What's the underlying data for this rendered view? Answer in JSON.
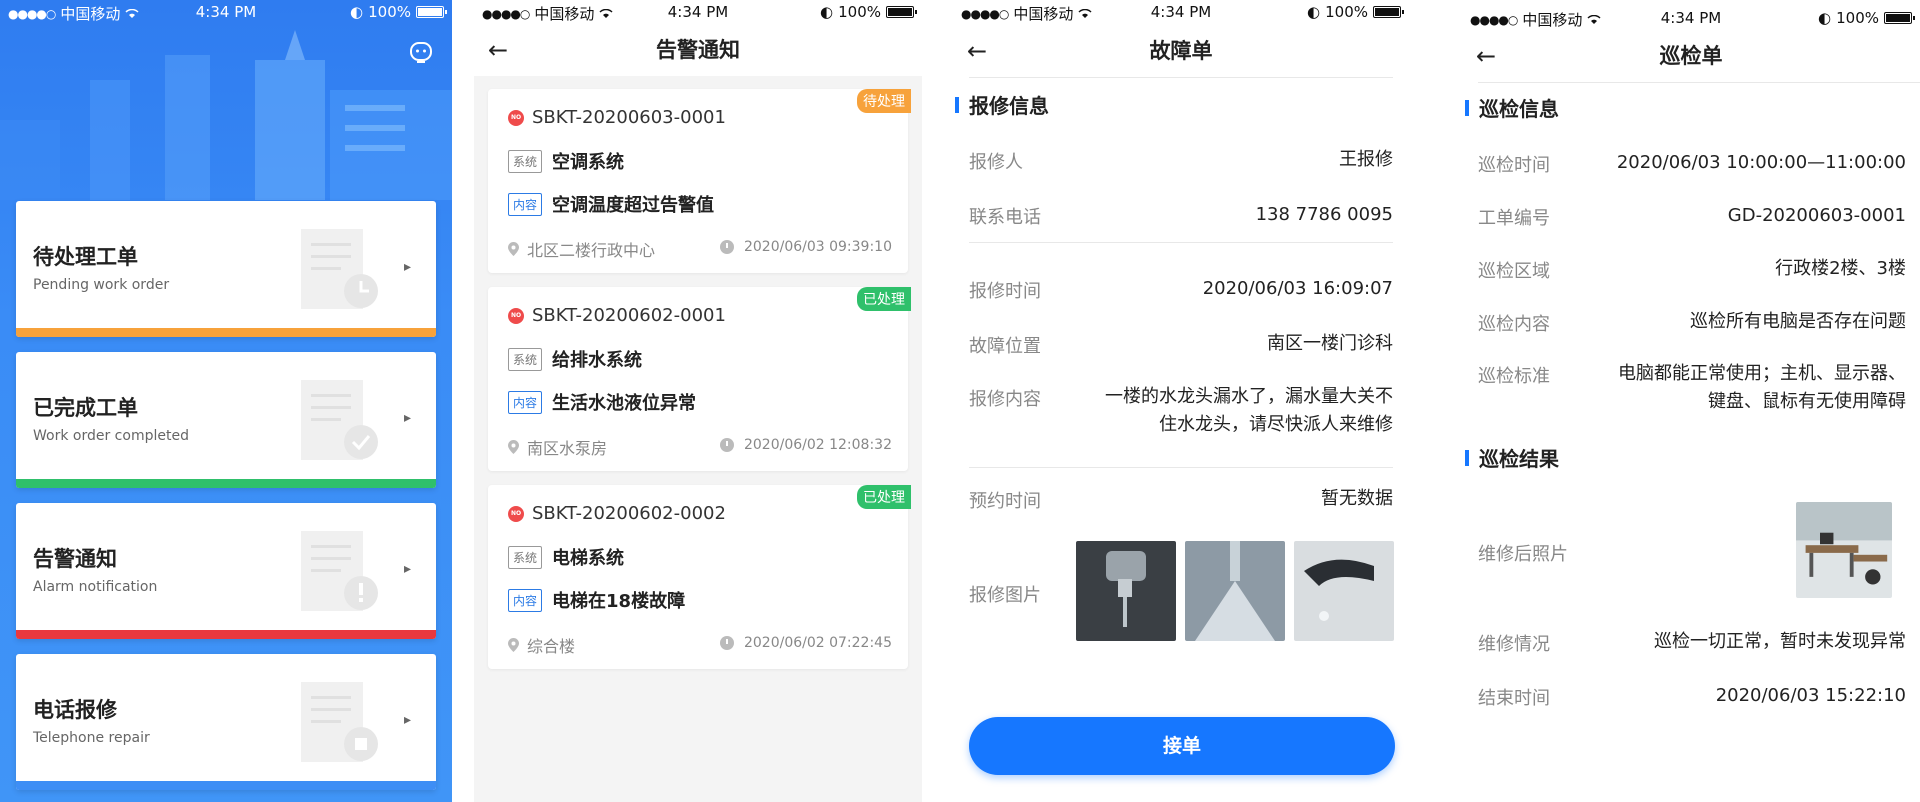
{
  "status_bar": {
    "carrier": "中国移动",
    "time": "4:34 PM",
    "battery": "100%"
  },
  "home": {
    "cards": [
      {
        "title": "待处理工单",
        "subtitle": "Pending work order",
        "color": "#f7a23b",
        "icon": "clock-doc-icon"
      },
      {
        "title": "已完成工单",
        "subtitle": "Work order completed",
        "color": "#2fc06b",
        "icon": "check-doc-icon"
      },
      {
        "title": "告警通知",
        "subtitle": "Alarm notification",
        "color": "#e9383f",
        "icon": "alert-doc-icon"
      },
      {
        "title": "电话报修",
        "subtitle": "Telephone repair",
        "color": "#3e8ef5",
        "icon": "phone-doc-icon"
      }
    ]
  },
  "alarms": {
    "title": "告警通知",
    "tag_system": "系统",
    "tag_content": "内容",
    "items": [
      {
        "code": "SBKT-20200603-0001",
        "status": "待处理",
        "status_color": "#f7a23b",
        "system": "空调系统",
        "content": "空调温度超过告警值",
        "location": "北区二楼行政中心",
        "datetime": "2020/06/03 09:39:10"
      },
      {
        "code": "SBKT-20200602-0001",
        "status": "已处理",
        "status_color": "#2fc06b",
        "system": "给排水系统",
        "content": "生活水池液位异常",
        "location": "南区水泵房",
        "datetime": "2020/06/02 12:08:32"
      },
      {
        "code": "SBKT-20200602-0002",
        "status": "已处理",
        "status_color": "#2fc06b",
        "system": "电梯系统",
        "content": "电梯在18楼故障",
        "location": "综合楼",
        "datetime": "2020/06/02 07:22:45"
      }
    ]
  },
  "fault": {
    "title": "故障单",
    "section": "报修信息",
    "reporter_label": "报修人",
    "reporter": "王报修",
    "phone_label": "联系电话",
    "phone": "138 7786 0095",
    "time_label": "报修时间",
    "time": "2020/06/03 16:09:07",
    "location_label": "故障位置",
    "location": "南区一楼门诊科",
    "content_label": "报修内容",
    "content_line1": "一楼的水龙头漏水了，漏水量大关不",
    "content_line2": "住水龙头，请尽快派人来维修",
    "appointment_label": "预约时间",
    "appointment": "暂无数据",
    "photos_label": "报修图片",
    "button": "接单"
  },
  "inspection": {
    "title": "巡检单",
    "section_info": "巡检信息",
    "time_label": "巡检时间",
    "time": "2020/06/03 10:00:00—11:00:00",
    "order_label": "工单编号",
    "order": "GD-20200603-0001",
    "area_label": "巡检区域",
    "area": "行政楼2楼、3楼",
    "content_label": "巡检内容",
    "content": "巡检所有电脑是否存在问题",
    "standard_label": "巡检标准",
    "standard_line1": "电脑都能正常使用；主机、显示器、",
    "standard_line2": "键盘、鼠标有无使用障碍",
    "section_result": "巡检结果",
    "photo_label": "维修后照片",
    "repair_label": "维修情况",
    "repair": "巡检一切正常，暂时未发现异常",
    "end_label": "结束时间",
    "end": "2020/06/03 15:22:10"
  }
}
